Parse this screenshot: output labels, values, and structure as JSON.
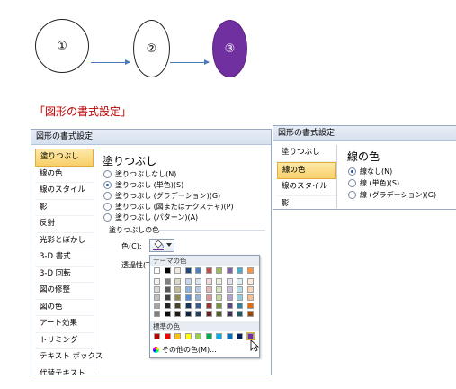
{
  "shapes": [
    {
      "label": "①",
      "fill": "#ffffff"
    },
    {
      "label": "②",
      "fill": "#ffffff"
    },
    {
      "label": "③",
      "fill": "#7030a0"
    }
  ],
  "caption": "「図形の書式設定」",
  "dialog_main": {
    "title": "図形の書式設定",
    "sidebar": [
      "塗りつぶし",
      "線の色",
      "線のスタイル",
      "影",
      "反射",
      "光彩とぼかし",
      "3-D 書式",
      "3-D 回転",
      "図の修整",
      "図の色",
      "アート効果",
      "トリミング",
      "テキスト ボックス",
      "代替テキスト"
    ],
    "heading": "塗りつぶし",
    "options": [
      "塗りつぶしなし(N)",
      "塗りつぶし (単色)(S)",
      "塗りつぶし (グラデーション)(G)",
      "塗りつぶし (図またはテクスチャ)(P)",
      "塗りつぶし (パターン)(A)"
    ],
    "selected_option": 1,
    "fill_color_label": "塗りつぶしの色",
    "color_label": "色(C):",
    "transparency_label": "透過性(T"
  },
  "picker": {
    "theme_label": "テーマの色",
    "standard_label": "標準の色",
    "more_colors": "その他の色(M)...",
    "theme_top": [
      "#ffffff",
      "#000000",
      "#eeece1",
      "#1f497d",
      "#4f81bd",
      "#c0504d",
      "#9bbb59",
      "#8064a2",
      "#4bacc6",
      "#f79646"
    ],
    "theme_shades": [
      [
        "#f2f2f2",
        "#808080",
        "#ddd9c3",
        "#c6d9f0",
        "#dbe5f1",
        "#f2dcdb",
        "#ebf1dd",
        "#e5e0ec",
        "#dbeef3",
        "#fdeada"
      ],
      [
        "#d8d8d8",
        "#595959",
        "#c4bd97",
        "#8db3e2",
        "#b8cce4",
        "#e5b9b7",
        "#d7e3bc",
        "#ccc1d9",
        "#b7dde8",
        "#fbd5b5"
      ],
      [
        "#bfbfbf",
        "#3f3f3f",
        "#938953",
        "#548dd4",
        "#95b3d7",
        "#d99694",
        "#c3d69b",
        "#b2a2c7",
        "#92cddc",
        "#fac08f"
      ],
      [
        "#a5a5a5",
        "#262626",
        "#494429",
        "#17365d",
        "#366092",
        "#953734",
        "#76923c",
        "#5f497a",
        "#31859b",
        "#e36c09"
      ],
      [
        "#7f7f7f",
        "#0c0c0c",
        "#1d1b10",
        "#0f243e",
        "#244061",
        "#632423",
        "#4f6128",
        "#3f3151",
        "#205867",
        "#974806"
      ]
    ],
    "standard": [
      "#c00000",
      "#ff0000",
      "#ffc000",
      "#ffff00",
      "#92d050",
      "#00b050",
      "#00b0f0",
      "#0070c0",
      "#002060",
      "#7030a0"
    ]
  },
  "dialog_side": {
    "title": "図形の書式設定",
    "sidebar": [
      "塗りつぶし",
      "線の色",
      "線のスタイル",
      "影"
    ],
    "heading": "線の色",
    "options": [
      "線なし(N)",
      "線 (単色)(S)",
      "線 (グラデーション)(G)"
    ],
    "selected_option": 0
  }
}
